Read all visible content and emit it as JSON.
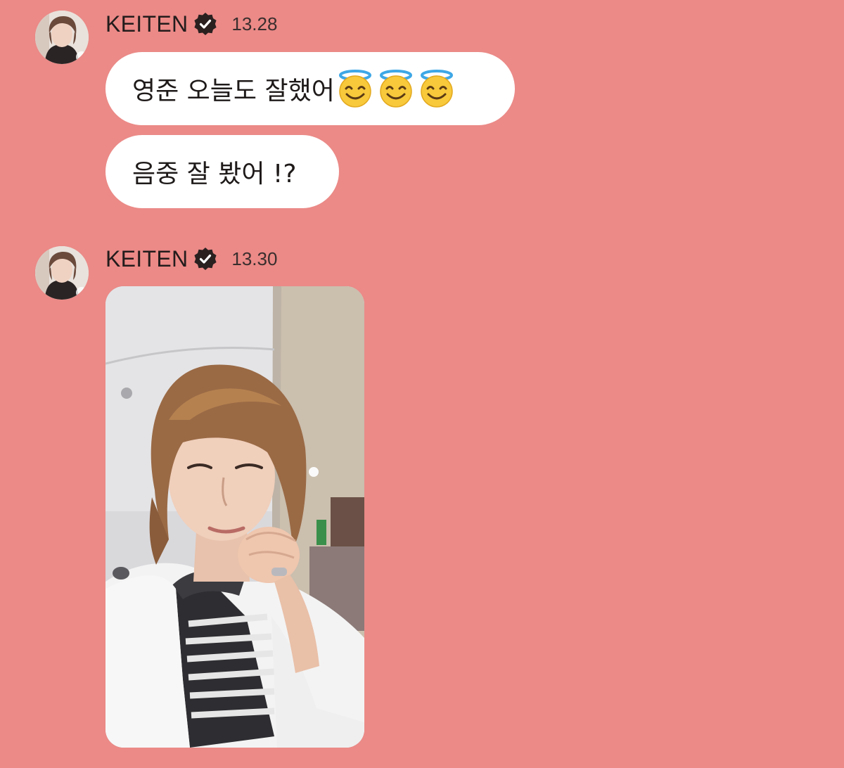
{
  "messages": [
    {
      "sender": "KEITEN",
      "time": "13.28",
      "bubbles": [
        {
          "text": "영준 오늘도 잘했어",
          "emoji": "smiling-face-with-halo",
          "emoji_count": 3
        },
        {
          "text": "음중 잘 봤어 !?"
        }
      ]
    },
    {
      "sender": "KEITEN",
      "time": "13.30",
      "attachment": {
        "type": "photo",
        "subject": "selfie"
      }
    }
  ],
  "icons": {
    "verified": "verified-badge-icon",
    "emoji": "smiling-face-with-halo"
  },
  "colors": {
    "background": "#eb8a87",
    "bubble": "#ffffff",
    "text": "#231c1c"
  }
}
